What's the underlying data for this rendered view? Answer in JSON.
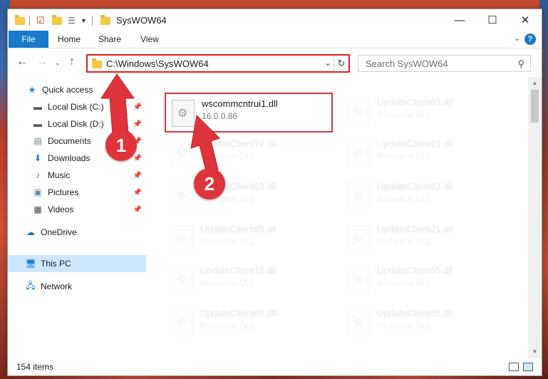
{
  "window": {
    "title": "SysWOW64",
    "minimize_icon": "minimize-icon",
    "maximize_icon": "maximize-icon",
    "close_icon": "close-icon"
  },
  "ribbon": {
    "tabs": [
      "File",
      "Home",
      "Share",
      "View"
    ],
    "help": "?"
  },
  "address": {
    "path": "C:\\Windows\\SysWOW64",
    "search_placeholder": "Search SysWOW64"
  },
  "nav_pane": {
    "items": [
      {
        "label": "Quick access",
        "icon": "star-icon",
        "pinned": false
      },
      {
        "label": "Local Disk (C:)",
        "icon": "drive-icon",
        "pinned": true
      },
      {
        "label": "Local Disk (D:)",
        "icon": "drive-icon",
        "pinned": true
      },
      {
        "label": "Documents",
        "icon": "documents-icon",
        "pinned": true
      },
      {
        "label": "Downloads",
        "icon": "download-icon",
        "pinned": true
      },
      {
        "label": "Music",
        "icon": "music-icon",
        "pinned": true
      },
      {
        "label": "Pictures",
        "icon": "pictures-icon",
        "pinned": true
      },
      {
        "label": "Videos",
        "icon": "videos-icon",
        "pinned": true
      },
      {
        "label": "OneDrive",
        "icon": "cloud-icon",
        "pinned": false
      },
      {
        "label": "This PC",
        "icon": "computer-icon",
        "pinned": false,
        "selected": true
      },
      {
        "label": "Network",
        "icon": "network-icon",
        "pinned": false
      }
    ]
  },
  "files": {
    "highlighted": {
      "name": "wscommcntrui1.dll",
      "detail": "16.0.0.86"
    },
    "left_column": [
      {
        "name": "UpdateClient19.dll",
        "detail": "Resource DLL"
      },
      {
        "name": "UpdateClient63.dll",
        "detail": "Resource DLL"
      },
      {
        "name": "UpdateClient65.dll",
        "detail": "Resource DLL"
      },
      {
        "name": "UpdateClient19.dll",
        "detail": "Resource DLL"
      },
      {
        "name": "UpdateClient65.dll",
        "detail": "Resource DLL"
      }
    ],
    "right_column": [
      {
        "name": "UpdateClient63.dll",
        "detail": "Resource DLL"
      },
      {
        "name": "UpdateClient19.dll",
        "detail": "Resource DLL"
      },
      {
        "name": "UpdateClient63.dll",
        "detail": "Resource DLL"
      },
      {
        "name": "UpdateClient21.dll",
        "detail": "Resource DLL"
      },
      {
        "name": "UpdateClient65.dll",
        "detail": "Resource DLL"
      },
      {
        "name": "UpdateClient65.dll",
        "detail": "Resource DLL"
      }
    ]
  },
  "status": {
    "item_count": "154 items"
  },
  "annotations": {
    "step1": "1",
    "step2": "2",
    "color": "#e0343c"
  }
}
